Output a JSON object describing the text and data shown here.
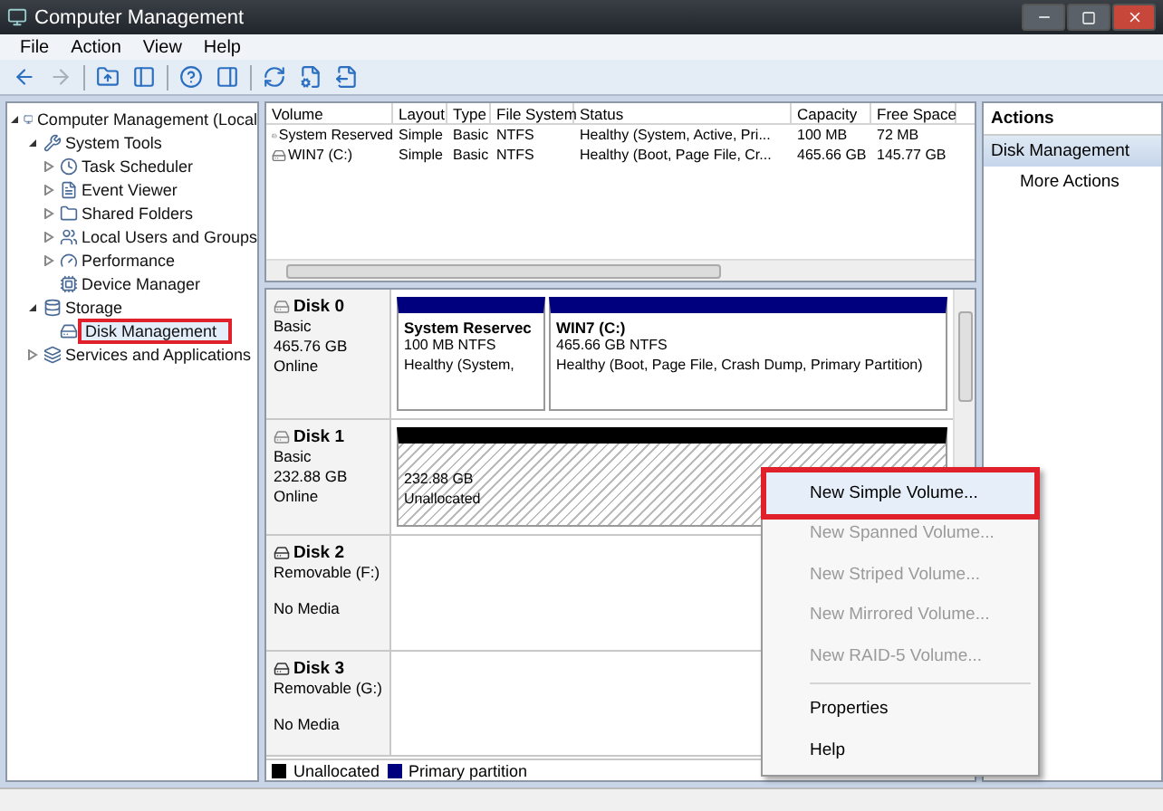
{
  "window": {
    "title": "Computer Management"
  },
  "menu": [
    "File",
    "Action",
    "View",
    "Help"
  ],
  "toolbar": [
    {
      "kind": "back",
      "disabled": false
    },
    {
      "kind": "forward",
      "disabled": true
    },
    {
      "kind": "sep"
    },
    {
      "kind": "up",
      "disabled": false
    },
    {
      "kind": "tree",
      "disabled": false
    },
    {
      "kind": "sep"
    },
    {
      "kind": "help",
      "disabled": false
    },
    {
      "kind": "pane",
      "disabled": false
    },
    {
      "kind": "sep"
    },
    {
      "kind": "refresh",
      "disabled": false
    },
    {
      "kind": "properties",
      "disabled": false
    },
    {
      "kind": "export",
      "disabled": false
    }
  ],
  "tree": [
    {
      "label": "Computer Management (Local",
      "expanded": true,
      "selected": false,
      "children": [
        {
          "label": "System Tools",
          "expanded": true,
          "selected": false,
          "children": [
            {
              "label": "Task Scheduler",
              "expanded": false,
              "selected": false
            },
            {
              "label": "Event Viewer",
              "expanded": false,
              "selected": false
            },
            {
              "label": "Shared Folders",
              "expanded": false,
              "selected": false
            },
            {
              "label": "Local Users and Groups",
              "expanded": false,
              "selected": false
            },
            {
              "label": "Performance",
              "expanded": false,
              "selected": false
            },
            {
              "label": "Device Manager",
              "selected": false
            }
          ]
        },
        {
          "label": "Storage",
          "expanded": true,
          "selected": false,
          "children": [
            {
              "label": "Disk Management",
              "selected": true,
              "annotated": true
            }
          ]
        },
        {
          "label": "Services and Applications",
          "expanded": false,
          "selected": false
        }
      ]
    }
  ],
  "volumes": {
    "columns": [
      "Volume",
      "Layout",
      "Type",
      "File System",
      "Status",
      "Capacity",
      "Free Space"
    ],
    "rows": [
      [
        "System Reserved",
        "Simple",
        "Basic",
        "NTFS",
        "Healthy (System, Active, Pri...",
        "100 MB",
        "72 MB"
      ],
      [
        "WIN7 (C:)",
        "Simple",
        "Basic",
        "NTFS",
        "Healthy (Boot, Page File, Cr...",
        "465.66 GB",
        "145.77 GB"
      ]
    ]
  },
  "disks": [
    {
      "name": "Disk 0",
      "kind": "fixed",
      "lines": [
        "Basic",
        "465.76 GB",
        "Online"
      ],
      "partitions": [
        {
          "kind": "primary",
          "title": "System Reservec",
          "lines": [
            "100 MB NTFS",
            "Healthy (System,"
          ]
        },
        {
          "kind": "primary",
          "title": "WIN7  (C:)",
          "lines": [
            "465.66 GB NTFS",
            "Healthy (Boot, Page File, Crash Dump, Primary Partition)"
          ]
        }
      ]
    },
    {
      "name": "Disk 1",
      "kind": "fixed",
      "lines": [
        "Basic",
        "232.88 GB",
        "Online"
      ],
      "partitions": [
        {
          "kind": "unallocated",
          "lines": [
            "232.88 GB",
            "Unallocated"
          ]
        }
      ]
    },
    {
      "name": "Disk 2",
      "kind": "removable",
      "lines": [
        "Removable (F:)",
        "No Media"
      ]
    },
    {
      "name": "Disk 3",
      "kind": "removable",
      "lines": [
        "Removable (G:)",
        "No Media"
      ]
    }
  ],
  "legend": [
    {
      "label": "Unallocated",
      "color": "#000000"
    },
    {
      "label": "Primary partition",
      "color": "#00007f"
    }
  ],
  "context_menu": [
    {
      "kind": "item",
      "label": "New Simple Volume...",
      "disabled": false,
      "selected": true,
      "annotated": true
    },
    {
      "kind": "item",
      "label": "New Spanned Volume...",
      "disabled": true,
      "selected": false
    },
    {
      "kind": "item",
      "label": "New Striped Volume...",
      "disabled": true,
      "selected": false
    },
    {
      "kind": "item",
      "label": "New Mirrored Volume...",
      "disabled": true,
      "selected": false
    },
    {
      "kind": "item",
      "label": "New RAID-5 Volume...",
      "disabled": true,
      "selected": false
    },
    {
      "kind": "separator"
    },
    {
      "kind": "item",
      "label": "Properties",
      "disabled": false,
      "selected": false
    },
    {
      "kind": "item",
      "label": "Help",
      "disabled": false,
      "selected": false
    }
  ],
  "actions": {
    "title": "Actions",
    "section": "Disk Management",
    "items": [
      "More Actions"
    ]
  }
}
